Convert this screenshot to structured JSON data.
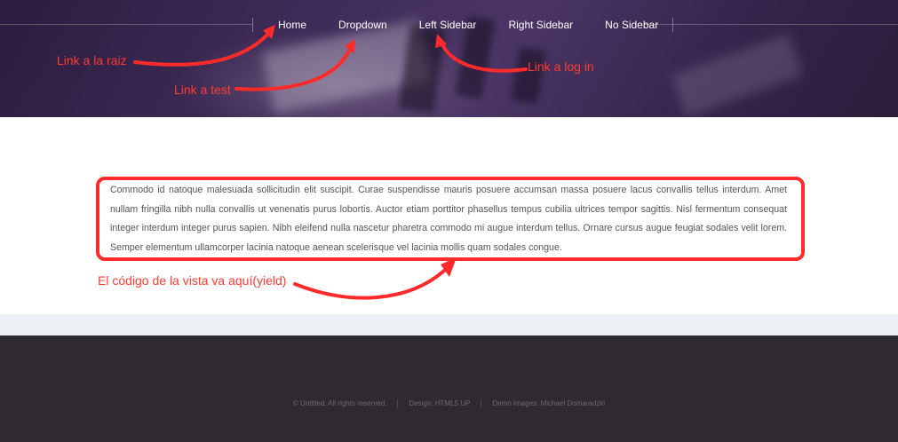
{
  "nav": {
    "items": [
      {
        "label": "Home"
      },
      {
        "label": "Dropdown"
      },
      {
        "label": "Left Sidebar"
      },
      {
        "label": "Right Sidebar"
      },
      {
        "label": "No Sidebar"
      }
    ]
  },
  "annotations": {
    "root_link": "Link a la raiz",
    "test_link": "Link a test",
    "login_link": "Link a log in",
    "view_code": "El código de la vista va aquí(yield)"
  },
  "main": {
    "paragraph": "Commodo id natoque malesuada sollicitudin elit suscipit. Curae suspendisse mauris posuere accumsan massa posuere lacus convallis tellus interdum. Amet nullam fringilla nibh nulla convallis ut venenatis purus lobortis. Auctor etiam porttitor phasellus tempus cubilia ultrices tempor sagittis. Nisl fermentum consequat integer interdum integer purus sapien. Nibh eleifend nulla nascetur pharetra commodo mi augue interdum tellus. Ornare cursus augue feugiat sodales velit lorem. Semper elementum ullamcorper lacinia natoque aenean scelerisque vel lacinia mollis quam sodales congue."
  },
  "footer": {
    "copyright": "© Untitled. All rights reserved.",
    "design": "Design: HTML5 UP",
    "images": "Demo Images: Michael Domaradzki"
  },
  "colors": {
    "annotation": "#ff2a2a",
    "header_bg": "#3d2a56",
    "footer_bg": "#2e2a30"
  }
}
